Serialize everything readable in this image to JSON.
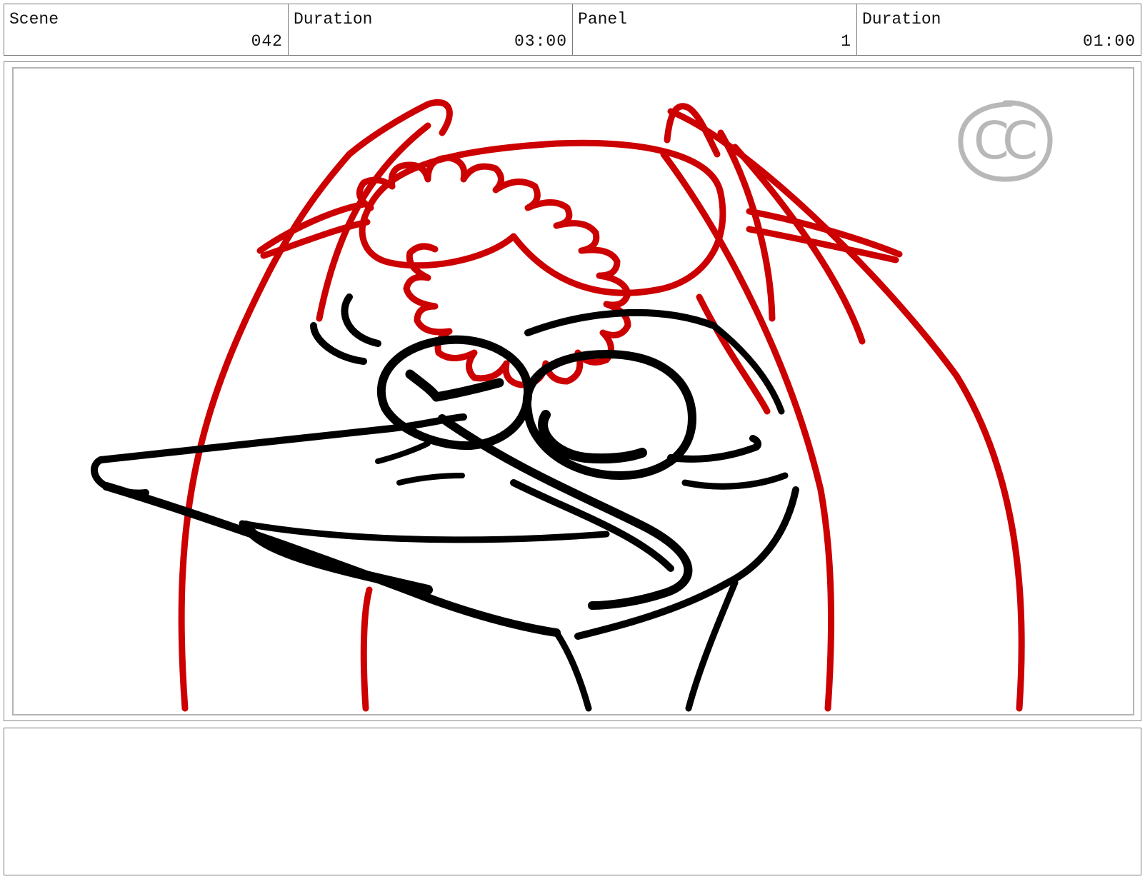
{
  "header": {
    "cells": [
      {
        "label": "Scene",
        "value": "042"
      },
      {
        "label": "Duration",
        "value": "03:00"
      },
      {
        "label": "Panel",
        "value": "1"
      },
      {
        "label": "Duration",
        "value": "01:00"
      }
    ]
  },
  "panel": {
    "watermark_text": "CC",
    "line_colors": {
      "construction": "#cc0000",
      "ink": "#000000",
      "frame": "#b4b4b4",
      "watermark": "#b8b8b8"
    }
  },
  "notes": {
    "text": ""
  }
}
